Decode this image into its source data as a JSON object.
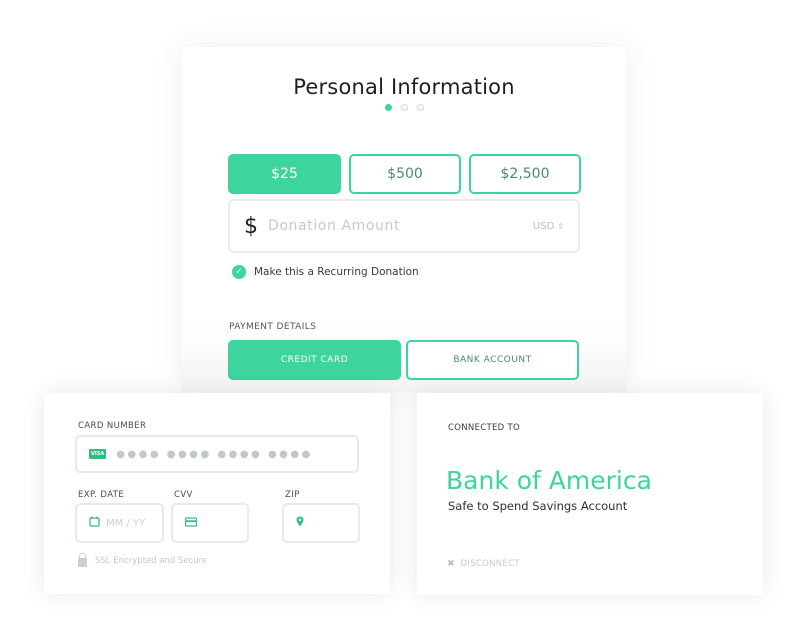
{
  "personal_info": {
    "title": "Personal Information",
    "steps": {
      "total": 3,
      "active": 1
    },
    "amount_options": [
      {
        "label": "$25",
        "selected": true
      },
      {
        "label": "$500",
        "selected": false
      },
      {
        "label": "$2,500",
        "selected": false
      }
    ],
    "donation_field": {
      "currency_symbol": "$",
      "placeholder": "Donation Amount",
      "value": "",
      "currency": "USD",
      "currency_caret": "⇕"
    },
    "recurring": {
      "checked": true,
      "check_glyph": "✓",
      "label": "Make this a Recurring Donation"
    },
    "payment_details_label": "PAYMENT DETAILS",
    "payment_tabs": [
      {
        "label": "CREDIT CARD",
        "selected": true
      },
      {
        "label": "BANK ACCOUNT",
        "selected": false
      }
    ]
  },
  "credit_card": {
    "card_number_label": "CARD NUMBER",
    "card_brand": "VISA",
    "card_number_masked": "●●●● ●●●● ●●●● ●●●●",
    "exp_label": "EXP. DATE",
    "exp_icon": "calendar-icon",
    "exp_placeholder": "MM / YY",
    "cvv_label": "CVV",
    "cvv_icon": "credit-card-icon",
    "zip_label": "ZIP",
    "zip_icon": "map-pin-icon",
    "ssl_text": "SSL Encrypted and Secure"
  },
  "bank_account": {
    "connected_label": "CONNECTED TO",
    "bank_name": "Bank of America",
    "account_name": "Safe to Spend Savings Account",
    "disconnect_glyph": "✖",
    "disconnect_label": "DISCONNECT"
  },
  "colors": {
    "accent": "#3dd49d",
    "accent_text": "#4a8a73",
    "border": "#e8ecea"
  }
}
